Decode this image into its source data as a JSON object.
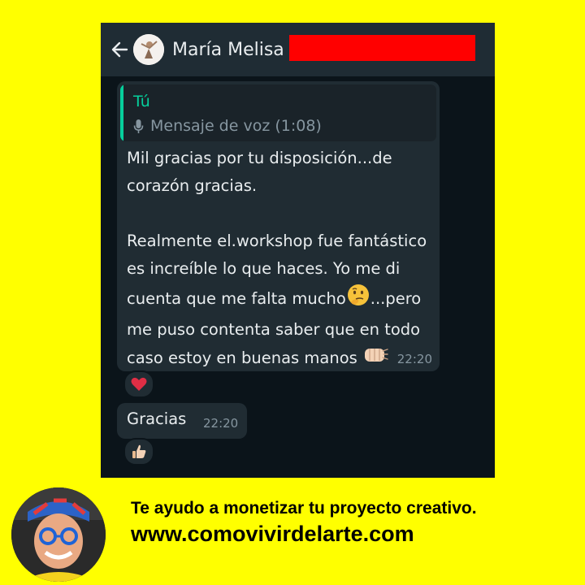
{
  "header": {
    "back_icon": "arrow-left-icon",
    "contact_name": "María Melisa",
    "avatar_icon": "contact-avatar"
  },
  "messages": [
    {
      "quote": {
        "author": "Tú",
        "icon": "microphone-icon",
        "text": "Mensaje de voz (1:08)"
      },
      "text_part1": "Mil gracias por tu disposición...de corazón gracias.\n\nRealmente el.workshop fue fantástico es increíble lo que haces. Yo me di cuenta que me falta mucho",
      "emoji1": "thinking-face-icon",
      "text_part2": "...pero me puso contenta saber que en todo caso estoy en buenas manos ",
      "emoji2": "fist-bump-icon",
      "time": "22:20",
      "reaction": "red-heart-icon"
    },
    {
      "text": "Gracias",
      "time": "22:20",
      "reaction": "thumbs-up-icon"
    }
  ],
  "promo": {
    "tagline": "Te ayudo a monetizar tu proyecto creativo.",
    "website": "www.comovivirdelarte.com"
  },
  "colors": {
    "page_background": "#ffff00",
    "chat_background": "#0b141a",
    "header_background": "#1f2c34",
    "bubble_background": "#202c33",
    "accent": "#06cf9c",
    "redaction": "#ff0000"
  }
}
